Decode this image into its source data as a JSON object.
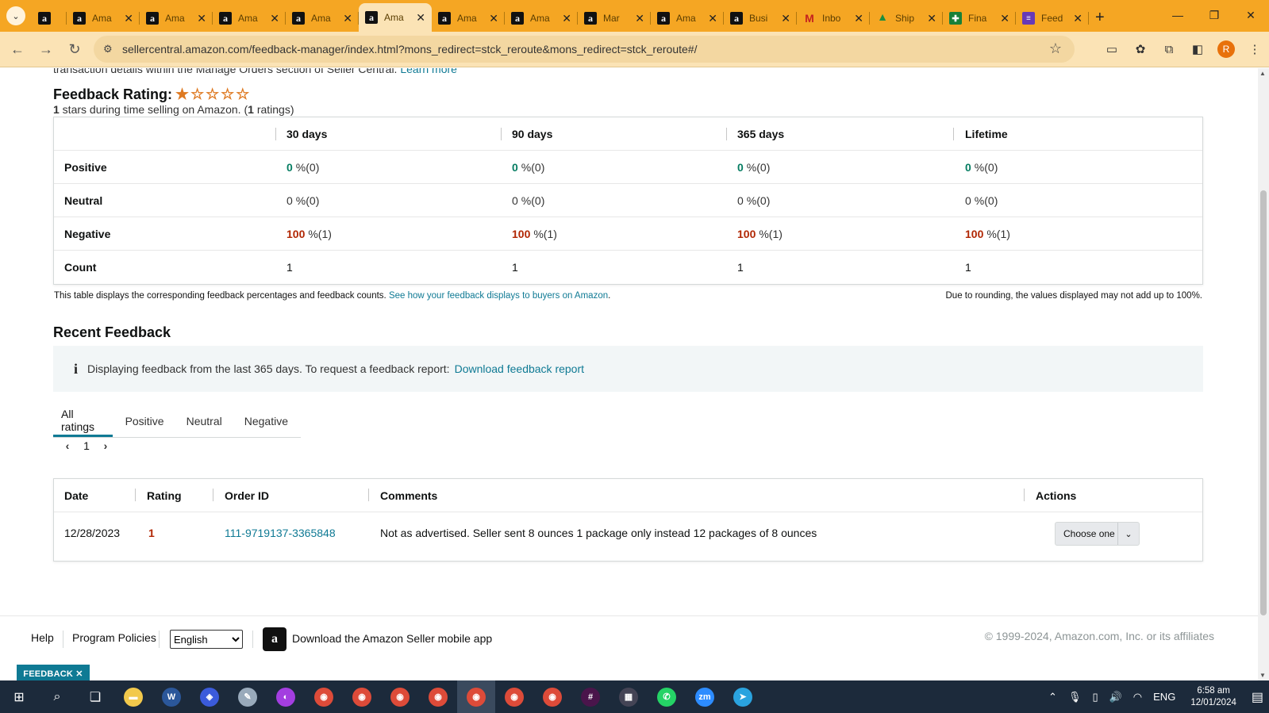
{
  "browser": {
    "tabs": [
      {
        "icon": "amazon-icon",
        "title": "",
        "active": false
      },
      {
        "icon": "amazon-icon",
        "title": "Ama",
        "active": false
      },
      {
        "icon": "amazon-icon",
        "title": "Ama",
        "active": false
      },
      {
        "icon": "amazon-icon",
        "title": "Ama",
        "active": false
      },
      {
        "icon": "amazon-icon",
        "title": "Ama",
        "active": false
      },
      {
        "icon": "amazon-icon",
        "title": "Ama",
        "active": true
      },
      {
        "icon": "amazon-icon",
        "title": "Ama",
        "active": false
      },
      {
        "icon": "amazon-icon",
        "title": "Ama",
        "active": false
      },
      {
        "icon": "amazon-icon",
        "title": "Mar",
        "active": false
      },
      {
        "icon": "amazon-icon",
        "title": "Ama",
        "active": false
      },
      {
        "icon": "amazon-icon",
        "title": "Busi",
        "active": false
      },
      {
        "icon": "gmail-icon",
        "title": "Inbo",
        "active": false
      },
      {
        "icon": "drive-icon",
        "title": "Ship",
        "active": false
      },
      {
        "icon": "sheets-icon",
        "title": "Fina",
        "active": false
      },
      {
        "icon": "forms-icon",
        "title": "Feed",
        "active": false
      }
    ],
    "url": "sellercentral.amazon.com/feedback-manager/index.html?mons_redirect=stck_reroute&mons_redirect=stck_reroute#/",
    "profile_initial": "R",
    "theme_color": "#f5a623"
  },
  "intro_cut": {
    "text": "transaction details within the Manage Orders section of Seller Central.",
    "link": "Learn more"
  },
  "rating": {
    "title": "Feedback Rating:",
    "stars_filled": 1,
    "stars_total": 5,
    "subtitle_count": "1",
    "subtitle_mid": " stars during time selling on Amazon. (",
    "subtitle_ratings": "1",
    "subtitle_end": " ratings)"
  },
  "feedback_table": {
    "columns": [
      "",
      "30 days",
      "90 days",
      "365 days",
      "Lifetime"
    ],
    "rows": [
      {
        "label": "Positive",
        "kind": "pos",
        "cells": [
          {
            "v": "0",
            "p": "%(0)"
          },
          {
            "v": "0",
            "p": "%(0)"
          },
          {
            "v": "0",
            "p": "%(0)"
          },
          {
            "v": "0",
            "p": "%(0)"
          }
        ]
      },
      {
        "label": "Neutral",
        "kind": "neu",
        "cells": [
          {
            "v": "0",
            "p": "%(0)"
          },
          {
            "v": "0",
            "p": "%(0)"
          },
          {
            "v": "0",
            "p": "%(0)"
          },
          {
            "v": "0",
            "p": "%(0)"
          }
        ]
      },
      {
        "label": "Negative",
        "kind": "neg",
        "cells": [
          {
            "v": "100",
            "p": "%(1)"
          },
          {
            "v": "100",
            "p": "%(1)"
          },
          {
            "v": "100",
            "p": "%(1)"
          },
          {
            "v": "100",
            "p": "%(1)"
          }
        ]
      },
      {
        "label": "Count",
        "kind": "count",
        "cells": [
          {
            "v": "1",
            "p": ""
          },
          {
            "v": "1",
            "p": ""
          },
          {
            "v": "1",
            "p": ""
          },
          {
            "v": "1",
            "p": ""
          }
        ]
      }
    ],
    "note": "This table displays the corresponding feedback percentages and feedback counts.",
    "note_link": "See how your feedback displays to buyers on Amazon",
    "note_right": "Due to rounding, the values displayed may not add up to 100%."
  },
  "recent": {
    "title": "Recent Feedback",
    "info_text": "Displaying feedback from the last 365 days. To request a feedback report:",
    "info_link": "Download feedback report",
    "tabs": [
      "All ratings",
      "Positive",
      "Neutral",
      "Negative"
    ],
    "active_tab": 0,
    "page": "1"
  },
  "orders_table": {
    "columns": [
      "Date",
      "Rating",
      "Order ID",
      "Comments",
      "Actions"
    ],
    "rows": [
      {
        "date": "12/28/2023",
        "rating": "1",
        "order_id": "111-9719137-3365848",
        "comment": "Not as advertised. Seller sent 8 ounces 1 package only instead 12 packages of 8 ounces",
        "action": "Choose one"
      }
    ]
  },
  "footer": {
    "help": "Help",
    "policies": "Program Policies",
    "language": "English",
    "app_text": "Download the Amazon Seller mobile app",
    "copyright": "© 1999-2024, Amazon.com, Inc. or its affiliates",
    "feedback_tag": "FEEDBACK ✕"
  },
  "taskbar": {
    "apps": [
      "start-icon",
      "search-icon",
      "task-view-icon",
      "file-explorer-icon",
      "word-icon",
      "vpn-icon",
      "notes-icon",
      "messenger-icon",
      "chrome-icon",
      "chrome-icon",
      "chrome-icon",
      "chrome-icon",
      "chrome-icon",
      "chrome-icon",
      "chrome-icon",
      "slack-icon",
      "calculator-icon",
      "whatsapp-icon",
      "zoom-icon",
      "telegram-icon"
    ],
    "language": "ENG",
    "time": "6:58 am",
    "date": "12/01/2024"
  }
}
